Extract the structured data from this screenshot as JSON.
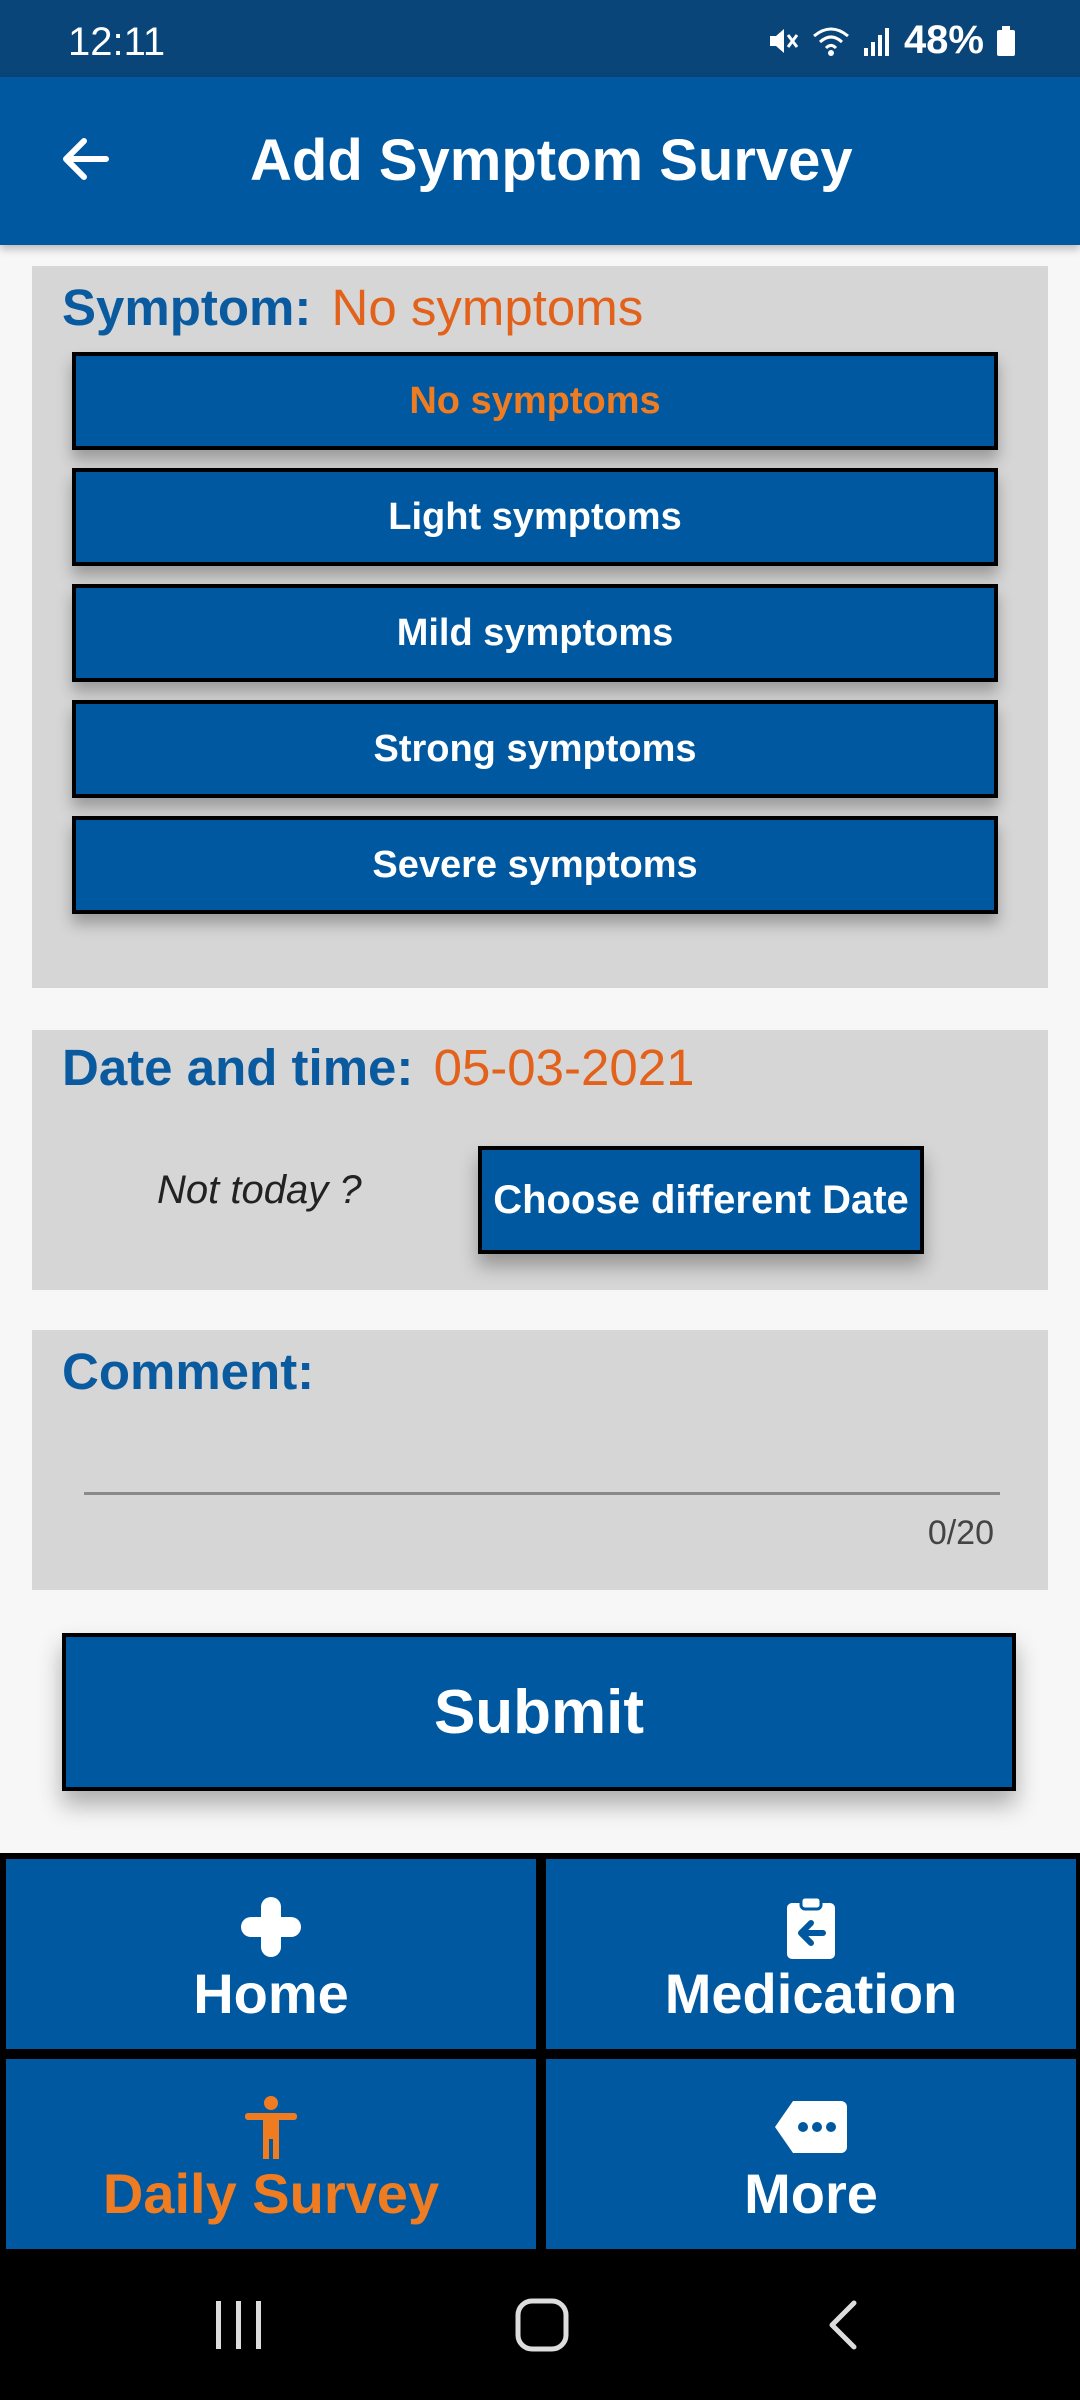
{
  "status_bar": {
    "time": "12:11",
    "battery": "48%"
  },
  "header": {
    "title": "Add Symptom Survey"
  },
  "symptom_card": {
    "label": "Symptom:",
    "selected_value": "No symptoms",
    "options": [
      "No symptoms",
      "Light symptoms",
      "Mild symptoms",
      "Strong symptoms",
      "Severe symptoms"
    ]
  },
  "date_card": {
    "label": "Date and time:",
    "value": "05-03-2021",
    "prompt": "Not today ?",
    "button_label": "Choose different Date"
  },
  "comment_card": {
    "label": "Comment:",
    "value": "",
    "counter": "0/20"
  },
  "submit_label": "Submit",
  "tabs": [
    {
      "label": "Home",
      "icon": "cross-icon"
    },
    {
      "label": "Medication",
      "icon": "clipboard-arrow-icon"
    },
    {
      "label": "Daily Survey",
      "icon": "person-icon",
      "active": true
    },
    {
      "label": "More",
      "icon": "more-tag-icon"
    }
  ],
  "colors": {
    "primary": "#0058a0",
    "status_bar": "#0a4579",
    "accent": "#f07c22",
    "value_text": "#e3621b",
    "card_bg": "#d6d6d6"
  }
}
